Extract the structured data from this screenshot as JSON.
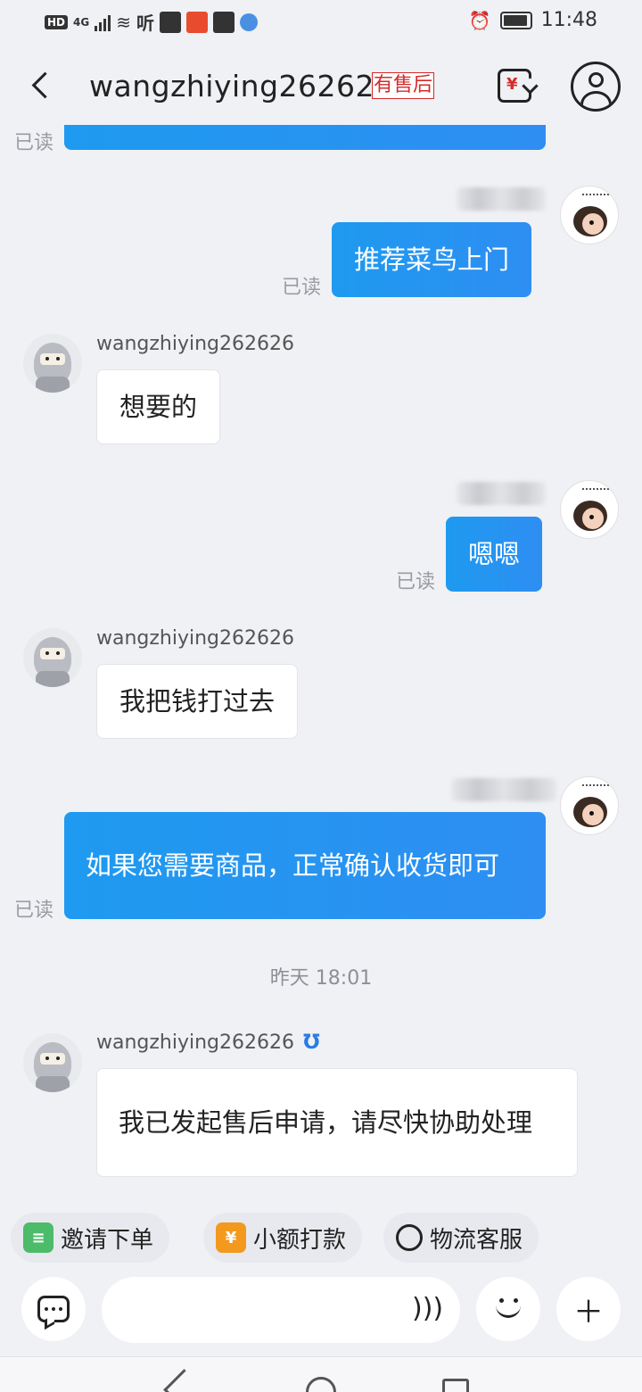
{
  "status_bar": {
    "hd": "HD",
    "network": "4G",
    "time": "11:48"
  },
  "header": {
    "title": "wangzhiying262626",
    "tag": "有售后",
    "refund_symbol": "¥"
  },
  "messages": {
    "read_label": "已读",
    "m1": "推荐菜鸟上门",
    "m2_sender": "wangzhiying262626",
    "m2": "想要的",
    "m3": "嗯嗯",
    "m4_sender": "wangzhiying262626",
    "m4": "我把钱打过去",
    "m5": "如果您需要商品，正常确认收货即可",
    "timestamp": "昨天 18:01",
    "m6_sender": "wangzhiying262626",
    "m6": "我已发起售后申请，请尽快协助处理"
  },
  "quick_actions": [
    {
      "label": "邀请下单",
      "icon": "invite-order-icon"
    },
    {
      "label": "小额打款",
      "icon": "small-payment-icon"
    },
    {
      "label": "物流客服",
      "icon": "logistics-service-icon"
    }
  ],
  "input": {
    "placeholder": ""
  },
  "colors": {
    "my_bubble": "#1e9af0",
    "their_bubble": "#ffffff",
    "tag_red": "#d52b2b",
    "background": "#f0f1f5"
  }
}
